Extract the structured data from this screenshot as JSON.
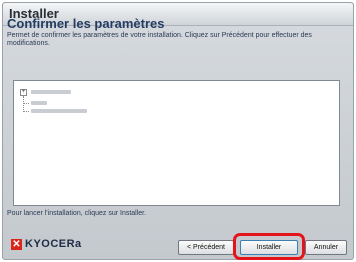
{
  "window": {
    "title": "Installer"
  },
  "page": {
    "heading": "Confirmer les paramètres",
    "description": "Permet de confirmer les paramètres de votre installation. Cliquez sur Précédent pour effectuer des modifications.",
    "hint": "Pour lancer l'installation, cliquez sur Installer."
  },
  "tree": {
    "expander_symbol": "+",
    "items_obscured": true
  },
  "brand": {
    "logo_text": "KYOCERa",
    "color": "#d9251c"
  },
  "buttons": {
    "previous": "< Précédent",
    "install": "Installer",
    "cancel": "Annuler"
  },
  "highlight_color": "#e4141b"
}
